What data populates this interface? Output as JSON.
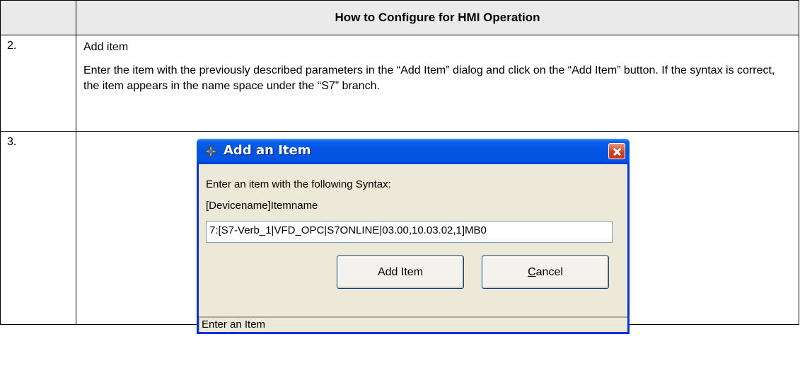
{
  "table": {
    "header": "How to Configure for HMI Operation",
    "rows": [
      {
        "number": "2.",
        "title": "Add item",
        "body": "Enter the item with the previously described parameters in the “Add Item” dialog and click on the “Add Item” button. If the syntax is correct, the item appears in the name space under the “S7” branch."
      },
      {
        "number": "3."
      }
    ]
  },
  "dialog": {
    "title": "Add an Item",
    "title_icon": "app-icon",
    "prompt": "Enter an item with the following Syntax:",
    "syntax": "[Devicename]Itemname",
    "item_value": "7:[S7-Verb_1|VFD_OPC|S7ONLINE|03.00,10.03.02,1]MB0",
    "add_button": "Add Item",
    "cancel_button_first": "C",
    "cancel_button_rest": "ancel",
    "status": "Enter an Item"
  }
}
